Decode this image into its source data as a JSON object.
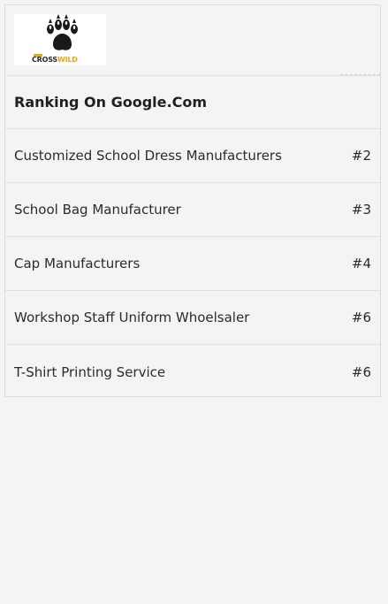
{
  "logo": {
    "brand_part1": "CROSS",
    "brand_part2": "WILD",
    "icon": "paw-icon",
    "colors": {
      "dark": "#1a1a1a",
      "accent": "#e0a820"
    }
  },
  "section": {
    "heading": "Ranking On Google.Com"
  },
  "rankings": [
    {
      "keyword": "Customized School Dress Manufacturers",
      "position": "#2"
    },
    {
      "keyword": "School Bag Manufacturer",
      "position": "#3"
    },
    {
      "keyword": "Cap Manufacturers",
      "position": "#4"
    },
    {
      "keyword": "Workshop Staff Uniform Whoelsaler",
      "position": "#6"
    },
    {
      "keyword": "T-Shirt Printing Service",
      "position": "#6"
    }
  ]
}
